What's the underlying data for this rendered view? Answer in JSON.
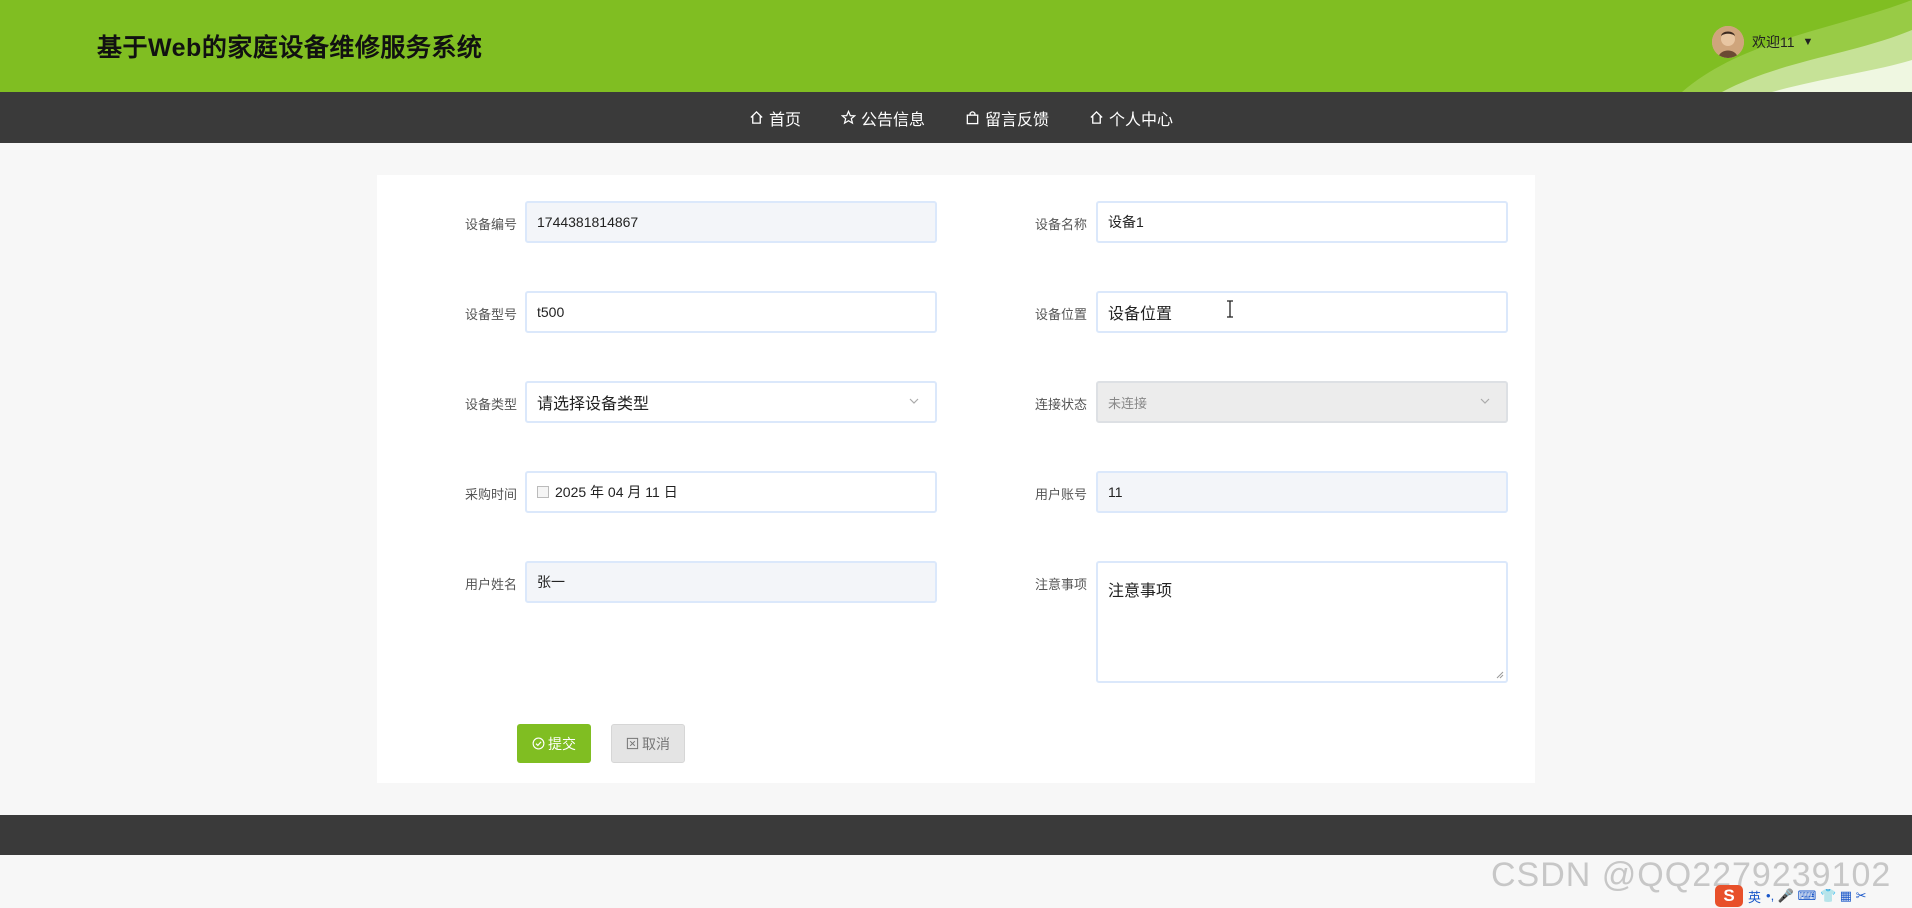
{
  "header": {
    "title": "基于Web的家庭设备维修服务系统",
    "welcome": "欢迎11",
    "caret": "▼",
    "brand_color": "#80be22"
  },
  "nav": {
    "items": [
      {
        "label": "首页",
        "icon": "home-icon"
      },
      {
        "label": "公告信息",
        "icon": "star-icon"
      },
      {
        "label": "留言反馈",
        "icon": "bag-icon"
      },
      {
        "label": "个人中心",
        "icon": "home-icon"
      }
    ]
  },
  "form": {
    "device_no": {
      "label": "设备编号",
      "value": "1744381814867"
    },
    "device_name": {
      "label": "设备名称",
      "value": "设备1"
    },
    "device_model": {
      "label": "设备型号",
      "value": "t500"
    },
    "device_location": {
      "label": "设备位置",
      "value": "设备位置"
    },
    "device_type": {
      "label": "设备类型",
      "value": "请选择设备类型"
    },
    "connection_status": {
      "label": "连接状态",
      "value": "未连接"
    },
    "purchase_date": {
      "label": "采购时间",
      "value": "2025 年 04 月 11 日"
    },
    "user_account": {
      "label": "用户账号",
      "value": "11"
    },
    "user_name": {
      "label": "用户姓名",
      "value": "张一"
    },
    "notes": {
      "label": "注意事项",
      "value": "注意事项"
    }
  },
  "buttons": {
    "submit": "提交",
    "cancel": "取消"
  },
  "watermark": "CSDN @QQ2279239102",
  "ime": {
    "logo": "S",
    "lang": "英",
    "symbols": "•, 🎤 ⌨ 👕 ▦ ✂"
  }
}
